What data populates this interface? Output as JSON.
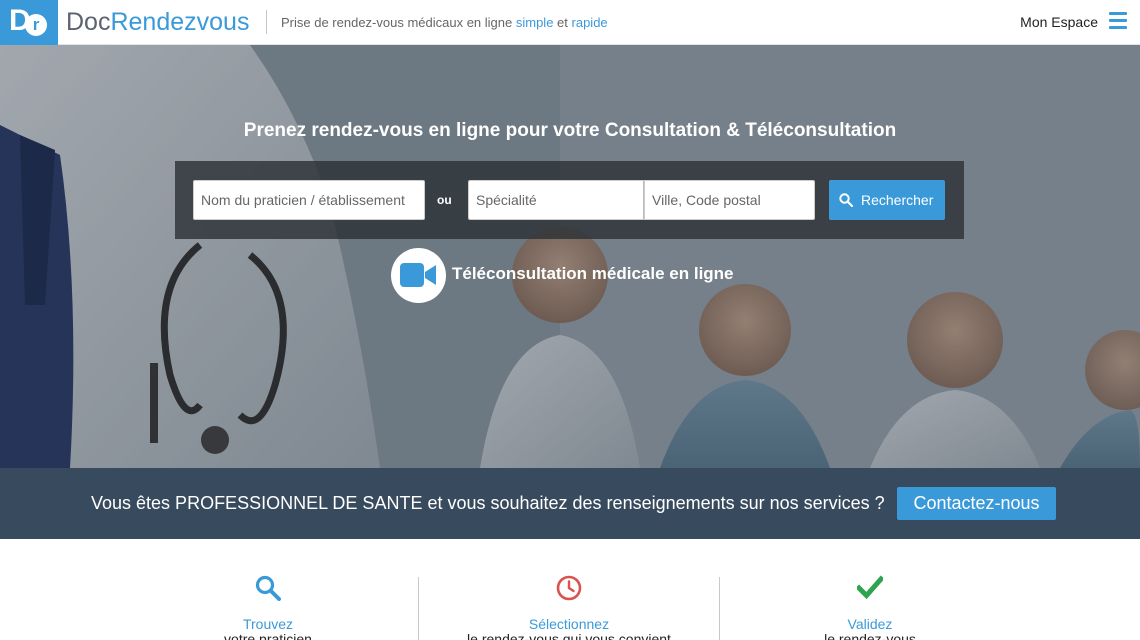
{
  "header": {
    "logo_letter_d": "D",
    "logo_letter_r": "r",
    "brand_doc": "Doc",
    "brand_rendezvous": "Rendezvous",
    "tagline_prefix": "Prise de rendez-vous médicaux en ligne ",
    "tagline_simple": "simple",
    "tagline_and": " et ",
    "tagline_rapide": "rapide",
    "account_label": "Mon Espace",
    "menu_icon": "hamburger-menu-icon"
  },
  "hero": {
    "title": "Prenez rendez-vous en ligne pour votre Consultation & Téléconsultation",
    "search": {
      "name_placeholder": "Nom du praticien / établissement",
      "or_label": "ou",
      "specialty_placeholder": "Spécialité",
      "city_placeholder": "Ville, Code postal",
      "button_label": "Rechercher",
      "button_icon": "search-icon"
    },
    "teleconsultation_icon": "video-camera-icon",
    "teleconsultation_label": "Téléconsultation médicale en ligne"
  },
  "pro_banner": {
    "text": "Vous êtes PROFESSIONNEL DE SANTE et vous souhaitez des renseignements sur nos services ?",
    "button_label": "Contactez-nous"
  },
  "steps": [
    {
      "icon": "search-icon",
      "title": "Trouvez",
      "subtitle": "votre praticien"
    },
    {
      "icon": "clock-icon",
      "title": "Sélectionnez",
      "subtitle": "le rendez-vous qui vous convient"
    },
    {
      "icon": "checkmark-icon",
      "title": "Validez",
      "subtitle": "le rendez-vous"
    }
  ],
  "colors": {
    "accent": "#3a9ad9",
    "banner": "#384a5e",
    "clock": "#d9534f",
    "check": "#2ea44f"
  }
}
